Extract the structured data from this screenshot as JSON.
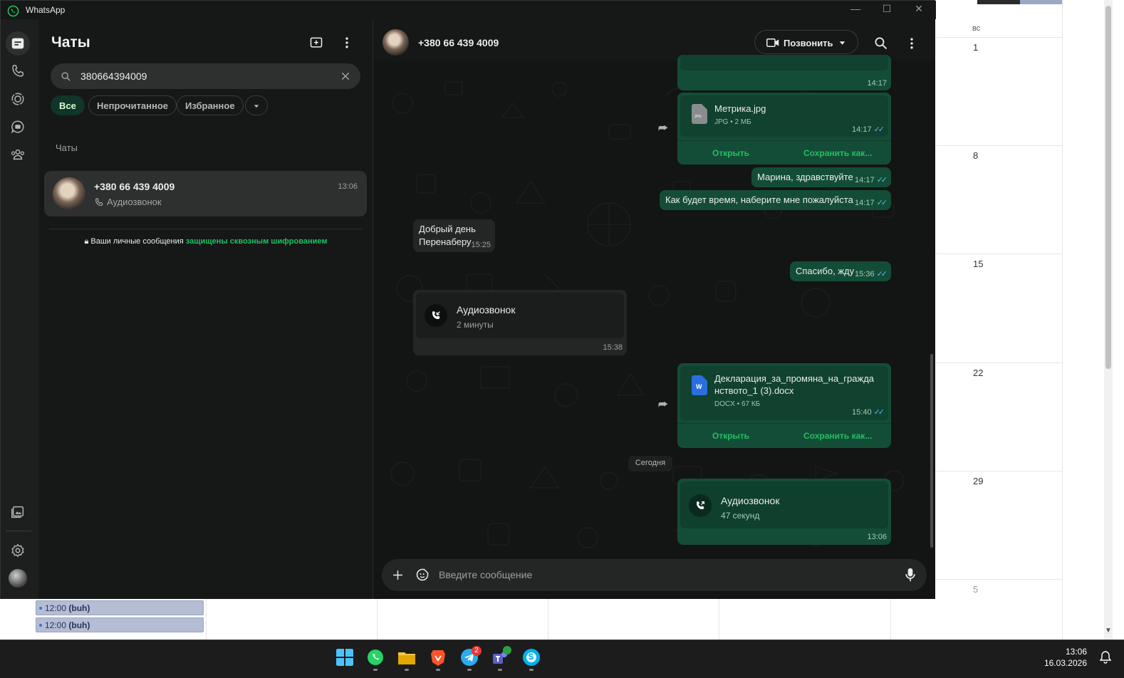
{
  "app": {
    "title": "WhatsApp"
  },
  "calendar": {
    "weekday": "вс",
    "days": [
      "1",
      "8",
      "15",
      "22",
      "29",
      "5"
    ],
    "events": [
      "12:00",
      "12:00"
    ],
    "event_tag": "(buh)"
  },
  "rail": {
    "items": [
      "chats",
      "calls",
      "status",
      "channels",
      "communities",
      "media",
      "settings",
      "profile"
    ]
  },
  "chatlist": {
    "title": "Чаты",
    "search_value": "380664394009",
    "filters": [
      "Все",
      "Непрочитанное",
      "Избранное"
    ],
    "section": "Чаты",
    "chat": {
      "name": "+380 66 439 4009",
      "time": "13:06",
      "preview": "Аудиозвонок"
    },
    "encryption_prefix": "Ваши личные сообщения ",
    "encryption_link": "защищены сквозным шифрованием"
  },
  "conversation": {
    "title": "+380 66 439 4009",
    "call_label": "Позвонить",
    "composer_placeholder": "Введите сообщение",
    "date_separator": "Сегодня",
    "messages": {
      "m0_time": "14:17",
      "doc1": {
        "name": "Метрика.jpg",
        "meta": "JPG • 2 МБ",
        "time": "14:17",
        "open": "Открыть",
        "save": "Сохранить как..."
      },
      "m1": {
        "text": "Марина, здравствуйте",
        "time": "14:17"
      },
      "m2": {
        "text": "Как будет время, наберите мне пожалуйста",
        "time": "14:17"
      },
      "m3": {
        "line1": "Добрый день",
        "line2": "Перенаберу",
        "time": "15:25"
      },
      "m4": {
        "text": "Спасибо, жду",
        "time": "15:36"
      },
      "call1": {
        "title": "Аудиозвонок",
        "duration": "2 минуты",
        "time": "15:38"
      },
      "doc2": {
        "line1": "Декларация_за_промяна_на_гражда",
        "line2": "нството_1 (3).docx",
        "meta": "DOCX • 67 КБ",
        "time": "15:40",
        "open": "Открыть",
        "save": "Сохранить как..."
      },
      "call2": {
        "title": "Аудиозвонок",
        "duration": "47 секунд",
        "time": "13:06"
      }
    }
  },
  "taskbar": {
    "time": "13:06",
    "date": "16.03.2026",
    "telegram_badge": "2",
    "apps": [
      "start",
      "whatsapp",
      "file-explorer",
      "brave",
      "telegram",
      "teams",
      "skype"
    ]
  },
  "colors": {
    "accent": "#21c063",
    "outgoing": "#144d37",
    "incoming": "#242626",
    "background": "#161717"
  }
}
